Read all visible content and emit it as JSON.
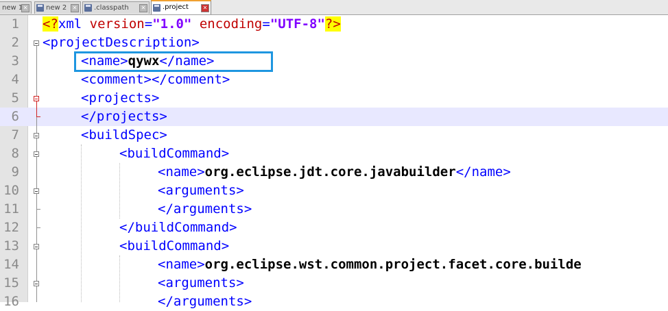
{
  "tabs": [
    {
      "label": "new 1",
      "active": false
    },
    {
      "label": "new 2",
      "active": false
    },
    {
      "label": ".classpath",
      "active": false
    },
    {
      "label": ".project",
      "active": true
    }
  ],
  "close_glyph": "✕",
  "editor": {
    "current_line": 6,
    "lines": [
      {
        "n": "1"
      },
      {
        "n": "2"
      },
      {
        "n": "3"
      },
      {
        "n": "4"
      },
      {
        "n": "5"
      },
      {
        "n": "6"
      },
      {
        "n": "7"
      },
      {
        "n": "8"
      },
      {
        "n": "9"
      },
      {
        "n": "10"
      },
      {
        "n": "11"
      },
      {
        "n": "12"
      },
      {
        "n": "13"
      },
      {
        "n": "14"
      },
      {
        "n": "15"
      },
      {
        "n": "16"
      }
    ],
    "code": {
      "l1_pi_open": "<?",
      "l1_xml": "xml ",
      "l1_attr1": "version",
      "l1_eq1": "=",
      "l1_val1": "\"1.0\"",
      "l1_sp": " ",
      "l1_attr2": "encoding",
      "l1_eq2": "=",
      "l1_val2": "\"UTF-8\"",
      "l1_pi_close": "?>",
      "l2": "<projectDescription>",
      "l3_open": "<name>",
      "l3_text": "qywx",
      "l3_close": "</name>",
      "l4": "<comment></comment>",
      "l5": "<projects>",
      "l6": "</projects>",
      "l7": "<buildSpec>",
      "l8": "<buildCommand>",
      "l9_open": "<name>",
      "l9_text": "org.eclipse.jdt.core.javabuilder",
      "l9_close": "</name>",
      "l10": "<arguments>",
      "l11": "</arguments>",
      "l12": "</buildCommand>",
      "l13": "<buildCommand>",
      "l14_open": "<name>",
      "l14_text": "org.eclipse.wst.common.project.facet.core.builde",
      "l15": "<arguments>",
      "l16": "</arguments>"
    }
  },
  "colors": {
    "tag": "#0000ff",
    "attribute": "#c00000",
    "string": "#8000ff",
    "pi_highlight": "#ffff00",
    "current_line": "#e8e8ff",
    "selection_box": "#1e96e0"
  }
}
